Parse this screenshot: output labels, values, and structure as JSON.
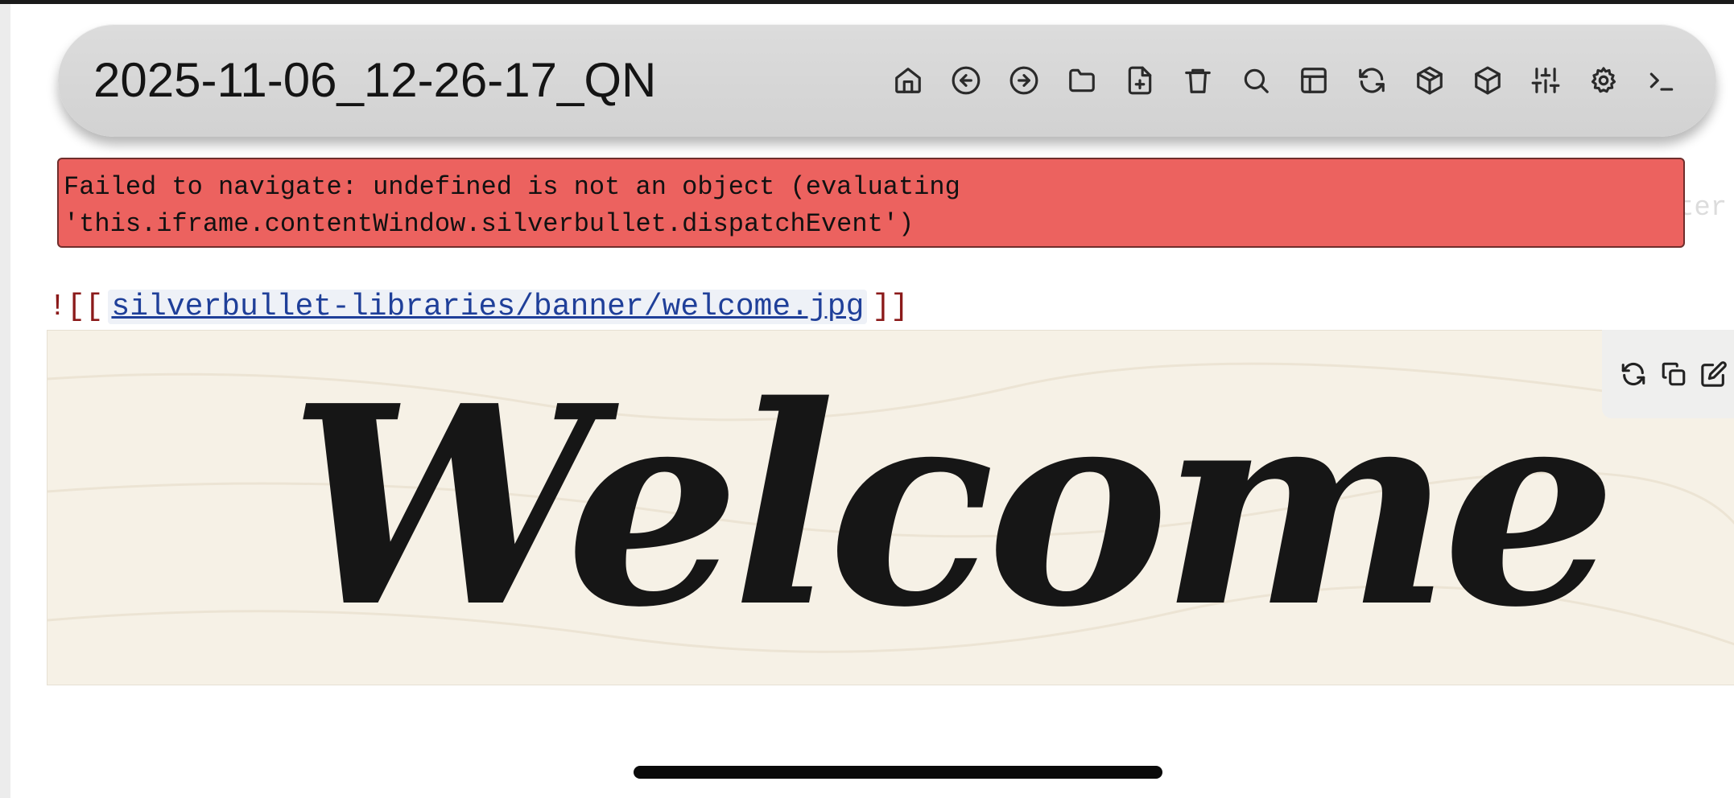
{
  "header": {
    "title": "2025-11-06_12-26-17_QN",
    "toolbar": [
      {
        "icon": "home-icon"
      },
      {
        "icon": "arrow-left-circle-icon"
      },
      {
        "icon": "arrow-right-circle-icon"
      },
      {
        "icon": "folder-icon"
      },
      {
        "icon": "file-plus-icon"
      },
      {
        "icon": "trash-icon"
      },
      {
        "icon": "search-icon"
      },
      {
        "icon": "layout-icon"
      },
      {
        "icon": "refresh-icon"
      },
      {
        "icon": "package-icon"
      },
      {
        "icon": "box-icon"
      },
      {
        "icon": "sliders-icon"
      },
      {
        "icon": "settings-icon"
      },
      {
        "icon": "terminal-icon"
      }
    ]
  },
  "error": {
    "line1": "Failed to navigate: undefined is not an object (evaluating",
    "line2": "'this.iframe.contentWindow.silverbullet.dispatchEvent')"
  },
  "background_text": "ter",
  "editor": {
    "prefix": "!",
    "open_brackets": "[[",
    "link": "silverbullet-libraries/banner/welcome.jpg",
    "close_brackets": "]]"
  },
  "banner": {
    "text": "Welcome",
    "background_color": "#f6f1e6",
    "actions": [
      {
        "icon": "refresh-icon"
      },
      {
        "icon": "copy-icon"
      },
      {
        "icon": "edit-icon"
      }
    ]
  },
  "colors": {
    "error_bg": "#ec625f",
    "link": "#1f3f99",
    "bracket": "#8b1a1a"
  }
}
